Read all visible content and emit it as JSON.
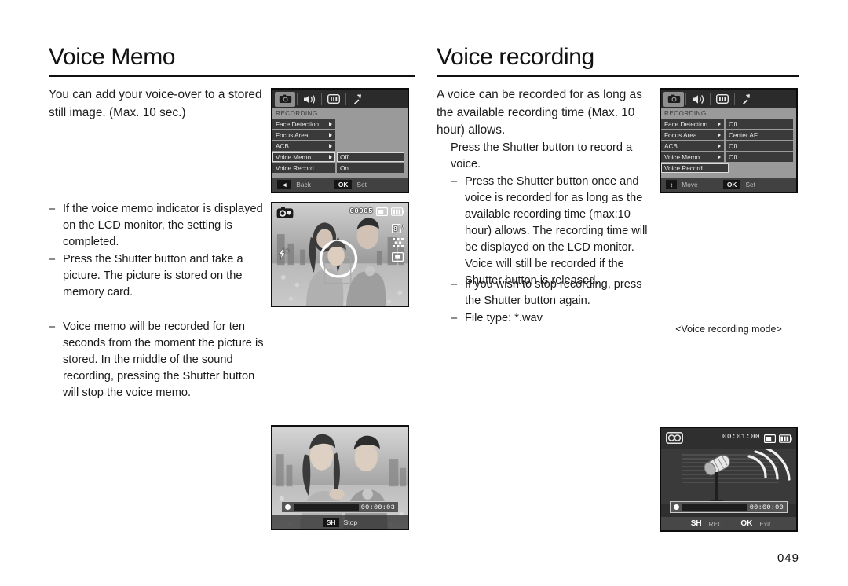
{
  "page": {
    "number": "049"
  },
  "left_column": {
    "heading": "Voice Memo",
    "lead": "You can add your voice-over to a stored still image. (Max. 10 sec.)",
    "bullets": [
      "If the voice memo indicator is displayed on the LCD monitor, the setting is completed.",
      "Press the Shutter button and take a picture. The picture is stored on the memory card.",
      "Voice memo will be recorded for ten seconds from the moment the picture is stored. In the middle of the sound recording, pressing the Shutter button will stop the voice memo."
    ],
    "dash": "–"
  },
  "right_column": {
    "heading": "Voice recording",
    "lead": "A voice can be recorded for as long as the available recording time (Max. 10 hour) allows.",
    "sub_lead": "Press the Shutter button to record a voice.",
    "bullets": [
      "Press the Shutter button once and voice is recorded for as long as the available recording time (max:10 hour) allows. The recording time will be displayed on the LCD monitor. Voice will still be recorded if the Shutter button is released.",
      "If you wish to stop recording, press the Shutter button again.",
      "File type: *.wav"
    ],
    "dash": "–"
  },
  "menu_left": {
    "tabs": [
      "camera-icon",
      "speaker-icon",
      "display-icon",
      "gear-icon"
    ],
    "selected_tab": "camera-icon",
    "section_title": "RECORDING",
    "rows": [
      {
        "label": "Face Detection",
        "value": "",
        "highlight": false
      },
      {
        "label": "Focus Area",
        "value": "",
        "highlight": false
      },
      {
        "label": "ACB",
        "value": "",
        "highlight": false
      },
      {
        "label": "Voice Memo",
        "value": "Off",
        "highlight": true
      },
      {
        "label": "Voice Record",
        "value": "On",
        "highlight": false
      }
    ],
    "footer": {
      "left_key": "◄",
      "left_label": "Back",
      "right_key": "OK",
      "right_label": "Set"
    }
  },
  "menu_right": {
    "tabs": [
      "camera-icon",
      "speaker-icon",
      "display-icon",
      "gear-icon"
    ],
    "selected_tab": "camera-icon",
    "section_title": "RECORDING",
    "rows": [
      {
        "label": "Face Detection",
        "value": "Off",
        "highlight": false
      },
      {
        "label": "Focus Area",
        "value": "Center AF",
        "highlight": false
      },
      {
        "label": "ACB",
        "value": "Off",
        "highlight": false
      },
      {
        "label": "Voice Memo",
        "value": "Off",
        "highlight": false
      },
      {
        "label": "Voice Record",
        "value": "",
        "highlight": true
      }
    ],
    "footer": {
      "left_key": "↕",
      "left_label": "Move",
      "right_key": "OK",
      "right_label": "Set"
    }
  },
  "photo_top": {
    "mode_icon": "voice-memo-camera-icon",
    "flash_icon": "flash-off-icon",
    "counter": "00005",
    "card_icon": "memory-card-icon",
    "battery_icon": "battery-full-icon",
    "right_icons": [
      "image-size-icon",
      "quality-icon",
      "metering-icon"
    ]
  },
  "photo_bottom": {
    "elapsed": "00:00:03",
    "key": "SH",
    "key_label": "Stop"
  },
  "voice_recording_lcd": {
    "mode_icon": "voice-record-icon",
    "available_time": "00:01:00",
    "card_icon": "memory-card-icon",
    "battery_icon": "battery-full-icon",
    "elapsed": "00:00:00",
    "shutter_key": "SH",
    "shutter_label": "REC",
    "ok_key": "OK",
    "ok_label": "Exit",
    "caption": "<Voice recording mode>"
  },
  "colors": {
    "ink": "#1a1a1a",
    "lcd_panel": "#9a9a9a",
    "lcd_row": "#3a3a3a",
    "lcd_tabbar": "#2b2b2b"
  }
}
